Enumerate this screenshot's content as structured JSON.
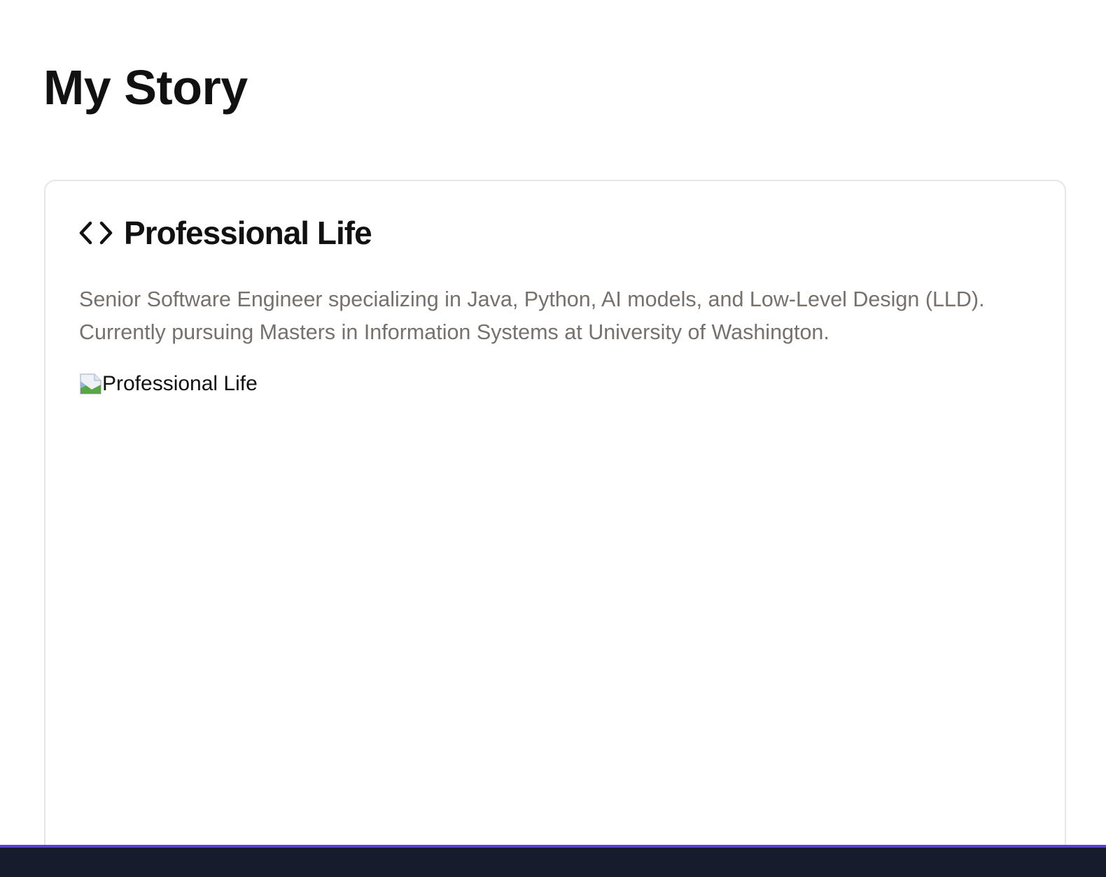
{
  "page": {
    "title": "My Story"
  },
  "card": {
    "icon": "code-icon",
    "title": "Professional Life",
    "description": "Senior Software Engineer specializing in Java, Python, AI models, and Low-Level Design (LLD). Currently pursuing Masters in Information Systems at University of Washington.",
    "image_alt": "Professional Life"
  },
  "colors": {
    "text": "#111111",
    "muted_text": "#77706b",
    "card_border": "#e6e6e6",
    "footer_bg": "#161c2b",
    "footer_accent": "#5b3fd6"
  }
}
